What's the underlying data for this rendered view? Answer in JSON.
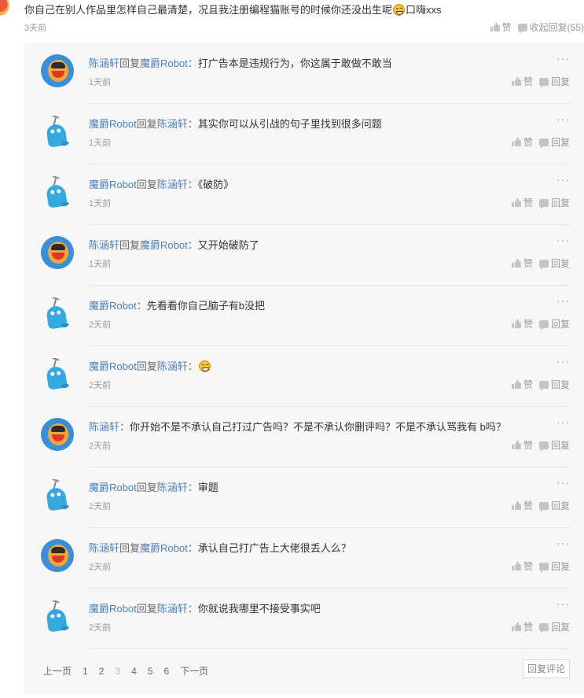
{
  "parent_comment": {
    "text_before": "你自己在别人作品里怎样自己最清楚，况且我注册编程猫账号的时候你还没出生呢",
    "text_after": "口嗨xxs",
    "time": "3天前",
    "like_label": "赞",
    "collapse_label": "收起回复(55)"
  },
  "replies": [
    {
      "user": "陈涵轩",
      "reply_word": "回复",
      "target": "魔爵Robot",
      "colon": "：",
      "content": "打广告本是违规行为，你这属于敢做不敢当",
      "time": "1天前",
      "avatar": "red-monkey",
      "has_emoji": false
    },
    {
      "user": "魔爵Robot",
      "reply_word": "回复",
      "target": "陈涵轩",
      "colon": "：",
      "content": "其实你可以从引战的句子里找到很多问题",
      "time": "1天前",
      "avatar": "blue-robot",
      "has_emoji": false
    },
    {
      "user": "魔爵Robot",
      "reply_word": "回复",
      "target": "陈涵轩",
      "colon": "：",
      "content": "《破防》",
      "time": "1天前",
      "avatar": "blue-robot",
      "has_emoji": false
    },
    {
      "user": "陈涵轩",
      "reply_word": "回复",
      "target": "魔爵Robot",
      "colon": "：",
      "content": "又开始破防了",
      "time": "1天前",
      "avatar": "red-monkey",
      "has_emoji": false
    },
    {
      "user": "魔爵Robot",
      "reply_word": "",
      "target": "",
      "colon": "：",
      "content": "先看看你自己脑子有b没把",
      "time": "2天前",
      "avatar": "blue-robot",
      "has_emoji": false
    },
    {
      "user": "魔爵Robot",
      "reply_word": "回复",
      "target": "陈涵轩",
      "colon": "：",
      "content": "",
      "time": "2天前",
      "avatar": "blue-robot",
      "has_emoji": true
    },
    {
      "user": "陈涵轩",
      "reply_word": "",
      "target": "",
      "colon": "：",
      "content": "你开始不是不承认自己打过广告吗？不是不承认你删评吗？不是不承认骂我有 b吗？",
      "time": "2天前",
      "avatar": "red-monkey",
      "has_emoji": false
    },
    {
      "user": "魔爵Robot",
      "reply_word": "回复",
      "target": "陈涵轩",
      "colon": "：",
      "content": "审题",
      "time": "2天前",
      "avatar": "blue-robot",
      "has_emoji": false
    },
    {
      "user": "陈涵轩",
      "reply_word": "回复",
      "target": "魔爵Robot",
      "colon": "：",
      "content": "承认自己打广告上大佬很丢人么？",
      "time": "2天前",
      "avatar": "red-monkey",
      "has_emoji": false
    },
    {
      "user": "魔爵Robot",
      "reply_word": "回复",
      "target": "陈涵轩",
      "colon": "：",
      "content": "你就说我哪里不接受事实吧",
      "time": "2天前",
      "avatar": "blue-robot",
      "has_emoji": false
    }
  ],
  "reply_actions": {
    "like_label": "赞",
    "reply_label": "回复",
    "more_label": "···"
  },
  "pagination": {
    "prev": "上一页",
    "pages": [
      "1",
      "2",
      "3",
      "4",
      "5",
      "6"
    ],
    "current": "3",
    "next": "下一页"
  },
  "reply_comment_button": "回复评论",
  "colors": {
    "username": "#4f7fb3",
    "panel_bg": "#f7f7f8",
    "meta": "#999999"
  }
}
